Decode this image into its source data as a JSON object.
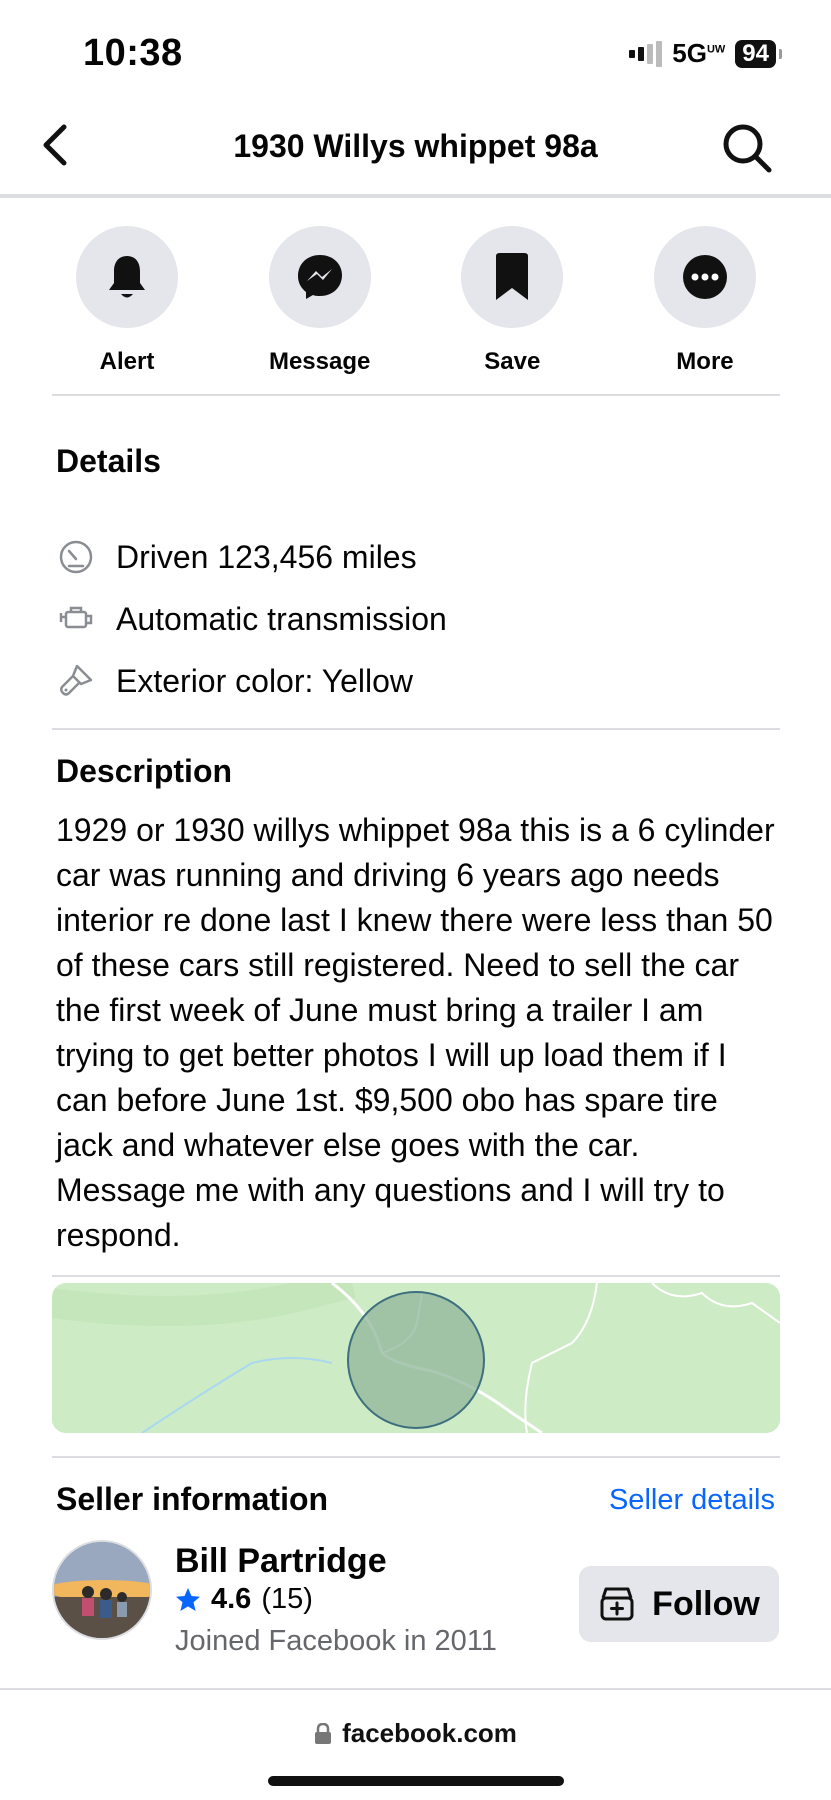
{
  "status_bar": {
    "time": "10:38",
    "network": "5G",
    "network_badge": "UW",
    "battery": "94"
  },
  "header": {
    "title": "1930 Willys whippet 98a",
    "back_icon": "chevron-left-icon",
    "search_icon": "search-icon"
  },
  "actions": [
    {
      "label": "Alert",
      "icon": "bell-icon"
    },
    {
      "label": "Message",
      "icon": "messenger-icon"
    },
    {
      "label": "Save",
      "icon": "bookmark-icon"
    },
    {
      "label": "More",
      "icon": "more-dots-icon"
    }
  ],
  "details": {
    "title": "Details",
    "items": [
      {
        "text": "Driven 123,456 miles",
        "icon": "speedometer-icon"
      },
      {
        "text": "Automatic transmission",
        "icon": "engine-icon"
      },
      {
        "text": "Exterior color: Yellow",
        "icon": "paint-brush-icon"
      }
    ]
  },
  "description": {
    "title": "Description",
    "text": "1929 or 1930 willys whippet 98a this is a 6 cylinder car was running and driving 6 years ago needs interior re done last I knew there were less than 50 of these cars still registered. Need to sell the car the first week of June must bring a trailer I am trying to get better photos I will up load them if I can before June 1st. $9,500 obo has spare tire jack and whatever else goes with the car. Message me with any questions and I will try to respond."
  },
  "seller": {
    "title": "Seller information",
    "details_link": "Seller details",
    "name": "Bill Partridge",
    "rating": "4.6",
    "rating_count": "(15)",
    "joined": "Joined Facebook in 2011",
    "follow_label": "Follow"
  },
  "url_bar": {
    "domain": "facebook.com"
  },
  "colors": {
    "accent": "#0866ff",
    "map_bg": "#cdebc4",
    "button_bg": "#e4e6eb"
  }
}
